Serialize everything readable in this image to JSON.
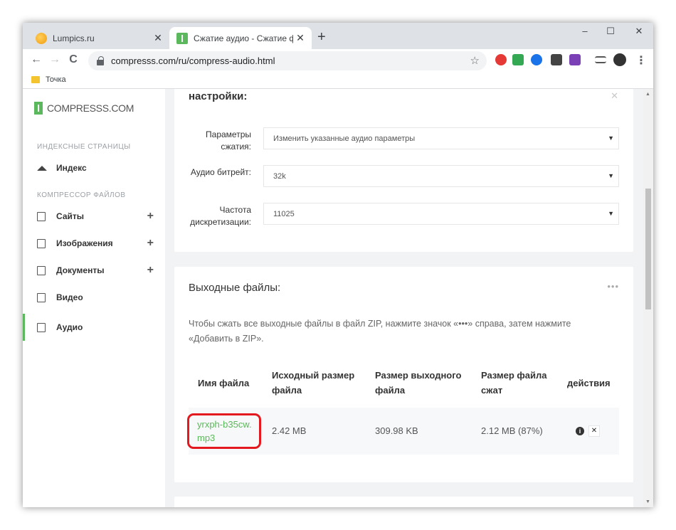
{
  "browser": {
    "tabs": [
      {
        "title": "Lumpics.ru",
        "close": "✕"
      },
      {
        "title": "Сжатие аудио - Сжатие файлов",
        "close": "✕"
      }
    ],
    "new_tab": "+",
    "window_controls": {
      "minimize": "–",
      "maximize": "☐",
      "close": "✕"
    },
    "nav": {
      "back": "←",
      "forward": "→",
      "reload": "C"
    },
    "url": "compresss.com/ru/compress-audio.html",
    "bookmark_folder": "Точка"
  },
  "site": {
    "logo": "COMPRESSS.COM",
    "sidebar": {
      "section1": "ИНДЕКСНЫЕ СТРАНИЦЫ",
      "section2": "КОМПРЕССОР ФАЙЛОВ",
      "items": [
        {
          "label": "Индекс",
          "plus": ""
        },
        {
          "label": "Сайты",
          "plus": "+"
        },
        {
          "label": "Изображения",
          "plus": "+"
        },
        {
          "label": "Документы",
          "plus": "+"
        },
        {
          "label": "Видео",
          "plus": ""
        },
        {
          "label": "Аудио",
          "plus": ""
        }
      ]
    }
  },
  "settings_card": {
    "title": "настройки:",
    "close": "✕",
    "fields": [
      {
        "label": "Параметры сжатия:",
        "value": "Изменить указанные аудио параметры"
      },
      {
        "label": "Аудио битрейт:",
        "value": "32k"
      },
      {
        "label": "Частота дискретизации:",
        "value": "11025"
      }
    ]
  },
  "output_card": {
    "title": "Выходные файлы:",
    "menu": "•••",
    "hint": "Чтобы сжать все выходные файлы в файл ZIP, нажмите значок «•••» справа, затем нажмите «Добавить в ZIP».",
    "headers": [
      "Имя файла",
      "Исходный размер файла",
      "Размер выходного файла",
      "Размер файла сжат",
      "действия"
    ],
    "row": {
      "filename": "yrxph-b35cw.mp3",
      "original_size": "2.42 MB",
      "output_size": "309.98 KB",
      "compressed": "2.12 MB (87%)",
      "info_icon": "i",
      "delete_icon": "✕"
    }
  }
}
